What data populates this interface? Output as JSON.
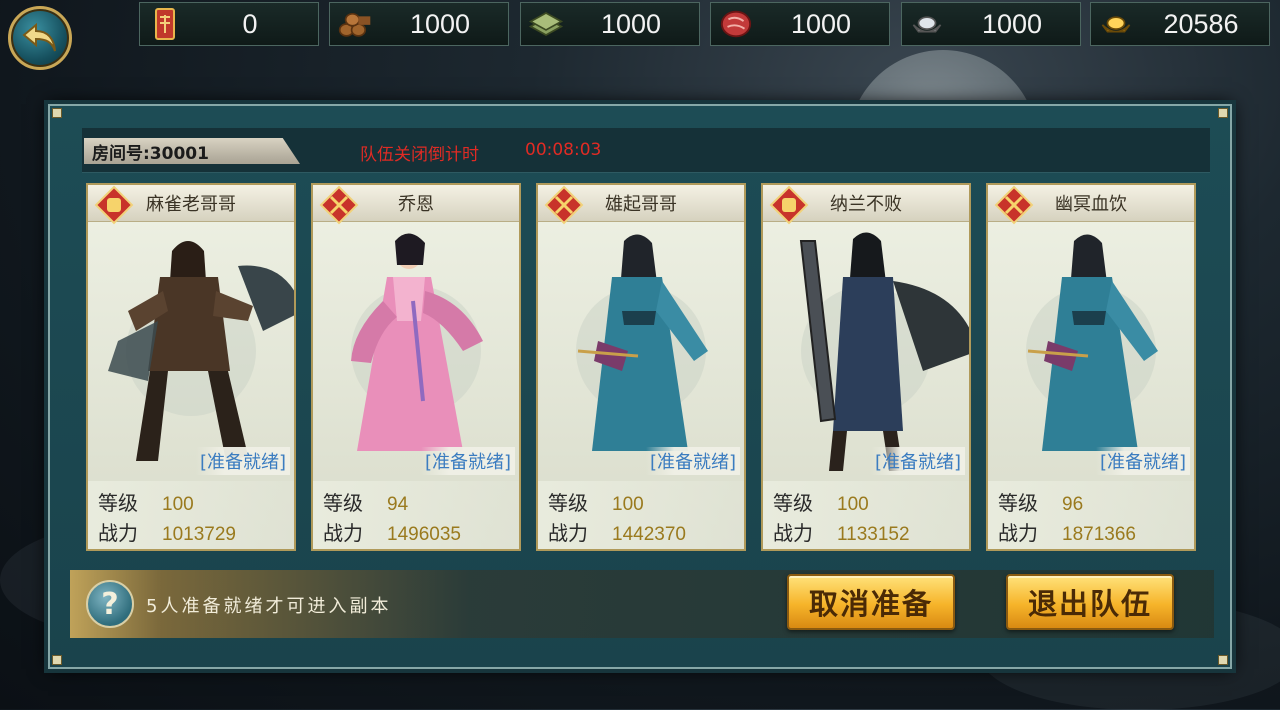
{
  "resources": [
    {
      "icon": "token-icon",
      "value": "0"
    },
    {
      "icon": "wood-icon",
      "value": "1000"
    },
    {
      "icon": "stone-icon",
      "value": "1000"
    },
    {
      "icon": "meat-icon",
      "value": "1000"
    },
    {
      "icon": "silver-ingot-icon",
      "value": "1000"
    },
    {
      "icon": "gold-ingot-icon",
      "value": "20586"
    }
  ],
  "room": {
    "label": "房间号:30001",
    "countdown_label": "队伍关闭倒计时",
    "countdown_value": "00:08:03"
  },
  "members": [
    {
      "name": "麻雀老哥哥",
      "class_icon": "fist-class-icon",
      "status": "[准备就绪]",
      "level_label": "等级",
      "level": "100",
      "power_label": "战力",
      "power": "1013729"
    },
    {
      "name": "乔恩",
      "class_icon": "crossed-swords-class-icon",
      "status": "[准备就绪]",
      "level_label": "等级",
      "level": "94",
      "power_label": "战力",
      "power": "1496035"
    },
    {
      "name": "雄起哥哥",
      "class_icon": "crossed-swords-class-icon",
      "status": "[准备就绪]",
      "level_label": "等级",
      "level": "100",
      "power_label": "战力",
      "power": "1442370"
    },
    {
      "name": "纳兰不败",
      "class_icon": "fist-class-icon",
      "status": "[准备就绪]",
      "level_label": "等级",
      "level": "100",
      "power_label": "战力",
      "power": "1133152"
    },
    {
      "name": "幽冥血饮",
      "class_icon": "crossed-swords-class-icon",
      "status": "[准备就绪]",
      "level_label": "等级",
      "level": "96",
      "power_label": "战力",
      "power": "1871366"
    }
  ],
  "footer": {
    "hint": "5人准备就绪才可进入副本",
    "cancel_ready_label": "取消准备",
    "leave_team_label": "退出队伍"
  },
  "colors": {
    "countdown": "#e02b24",
    "ready": "#3b7cc0",
    "stat_value": "#9a7a1e",
    "button_gold": "#f6b42a"
  }
}
